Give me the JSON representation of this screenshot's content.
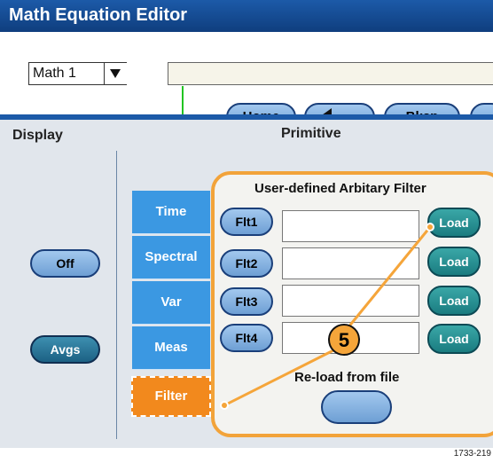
{
  "window": {
    "title": "Math Equation Editor"
  },
  "math_select": {
    "value": "Math 1"
  },
  "equation": {
    "value": ""
  },
  "editor_buttons": {
    "home": "Home",
    "bksp": "Bksp"
  },
  "display": {
    "heading": "Display",
    "off": "Off",
    "avgs": "Avgs"
  },
  "primitive": {
    "heading": "Primitive",
    "tabs": [
      {
        "label": "Time"
      },
      {
        "label": "Spectral"
      },
      {
        "label": "Var"
      },
      {
        "label": "Meas"
      },
      {
        "label": "Filter",
        "selected": true
      }
    ]
  },
  "filter_panel": {
    "title": "User-defined  Arbitary Filter",
    "rows": [
      {
        "flt": "Flt1",
        "value": "",
        "load": "Load"
      },
      {
        "flt": "Flt2",
        "value": "",
        "load": "Load"
      },
      {
        "flt": "Flt3",
        "value": "",
        "load": "Load"
      },
      {
        "flt": "Flt4",
        "value": "",
        "load": "Load"
      }
    ],
    "reload_label": "Re-load from file"
  },
  "callout": {
    "number": "5"
  },
  "figure_id": "1733-219",
  "colors": {
    "title_bar": "#1c5aa8",
    "selected_tab": "#f2891d",
    "callout": "#f5a53a",
    "connector": "#22c422",
    "tab": "#3b98e2"
  },
  "icons": {
    "dropdown": "triangle-down-icon",
    "backspace": "left-arrow-icon"
  }
}
